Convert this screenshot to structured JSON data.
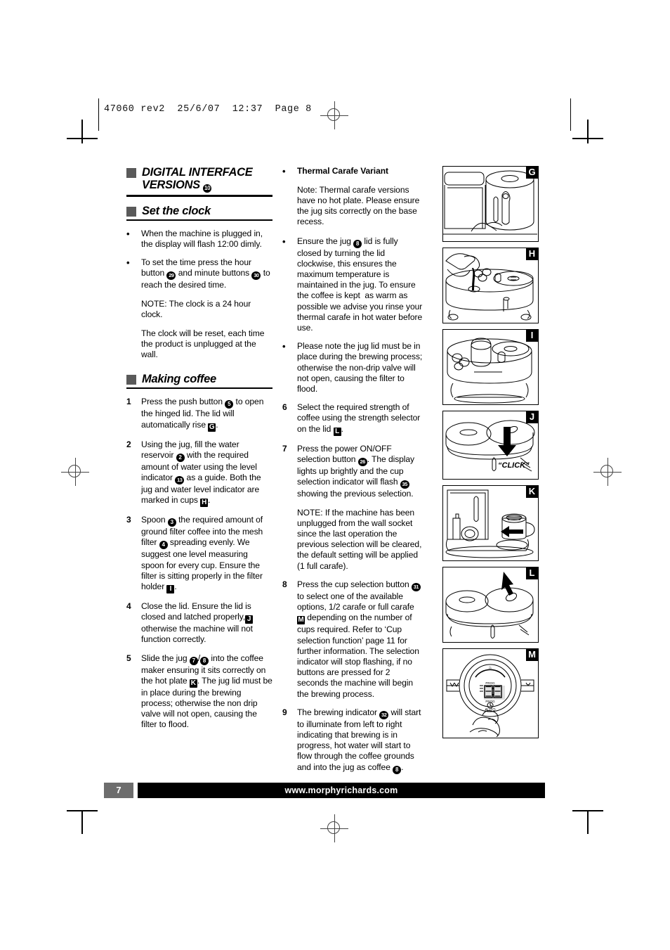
{
  "slug": "47060 rev2  25/6/07  12:37  Page 8",
  "footer": {
    "page_number": "7",
    "url": "www.morphyrichards.com"
  },
  "columns": {
    "left": {
      "heading_main": "DIGITAL INTERFACE VERSIONS",
      "heading_main_ref": "10",
      "heading_sub": "Set the clock",
      "clock_items": [
        {
          "marker": "•",
          "paragraphs": [
            "When the machine is plugged in, the display will flash 12:00 dimly."
          ]
        },
        {
          "marker": "•",
          "paragraphs": [
            "To set the time press the hour button [29] and minute buttons [30] to reach the desired time.",
            "NOTE: The clock is a 24 hour clock.",
            "The clock will be reset, each time the product is unplugged at the wall."
          ]
        }
      ],
      "heading_making": "Making coffee",
      "making_items": [
        {
          "marker": "1",
          "text_parts": [
            "Press the push button ",
            "5",
            " to open the hinged lid. The lid will automatically rise ",
            "G",
            "."
          ]
        },
        {
          "marker": "2",
          "text_parts": [
            "Using the jug, fill the water reservoir ",
            "2",
            " with the required amount of water using the level indicator ",
            "13",
            " as a guide. Both the jug and water level indicator are marked in cups ",
            "H",
            "."
          ]
        },
        {
          "marker": "3",
          "text_parts": [
            "Spoon ",
            "3",
            " the required amount of ground filter coffee into the mesh filter ",
            "4",
            " spreading evenly. We suggest one level measuring spoon for every cup. Ensure the filter is sitting properly in the filter holder ",
            "I",
            "."
          ]
        },
        {
          "marker": "4",
          "text_parts": [
            "Close the lid. Ensure the lid is closed and latched properly,",
            "J",
            " otherwise the machine will not function correctly."
          ]
        },
        {
          "marker": "5",
          "text_parts": [
            "Slide the jug ",
            "7",
            "/",
            "8",
            " into the coffee maker ensuring it sits correctly on the hot plate ",
            "K",
            ". The jug lid must be in place during the brewing process; otherwise the non drip valve will not open, causing the filter to flood."
          ]
        }
      ]
    },
    "middle": {
      "items": [
        {
          "marker": "•",
          "bold_title": "Thermal Carafe Variant",
          "paragraphs": [
            "Note: Thermal carafe versions have no hot plate. Please ensure the jug sits correctly on the base recess."
          ]
        },
        {
          "marker": "•",
          "text_parts": [
            "Ensure the jug ",
            "8",
            " lid is fully closed by turning the lid clockwise, this ensures the maximum temperature is maintained in the jug. To ensure the coffee is kept  as warm as possible we advise you rinse your thermal carafe in hot water before use."
          ]
        },
        {
          "marker": "•",
          "text_parts": [
            "Please note the jug lid must be in place during the brewing process; otherwise the non-drip valve will not open, causing the filter to flood."
          ]
        },
        {
          "marker": "6",
          "text_parts": [
            "Select the required strength of coffee using the strength selector on the lid ",
            "L",
            "."
          ]
        },
        {
          "marker": "7",
          "text_parts": [
            "Press the power ON/OFF selection button ",
            "26",
            ". The display lights up brightly and the cup selection indicator will flash ",
            "35",
            " showing the previous selection."
          ],
          "note": "NOTE: If the machine has been unplugged from the wall socket since the last operation the previous selection will be cleared, the default setting will be applied (1 full carafe)."
        },
        {
          "marker": "8",
          "text_parts": [
            "Press the cup selection button ",
            "31",
            " to select one of the available options, 1/2 carafe or full carafe ",
            "M",
            " depending on the number of cups required. Refer to ‘Cup selection function’ page 11 for further information. The selection indicator will stop flashing, if no buttons are pressed for 2 seconds the machine will begin the brewing process."
          ]
        },
        {
          "marker": "9",
          "text_parts": [
            "The brewing indicator ",
            "32",
            " will start to illuminate from left to right indicating that brewing is in progress, hot water will start to flow through the coffee grounds and into the jug as coffee ",
            "8",
            "."
          ]
        }
      ]
    },
    "right": {
      "panels": [
        {
          "tag": "G",
          "caption": "",
          "alt": "Finger pressing push button on coffee maker lid"
        },
        {
          "tag": "H",
          "caption": "",
          "alt": "Jug pouring water into the water reservoir"
        },
        {
          "tag": "I",
          "caption": "",
          "alt": "Open lid showing mesh filter in filter holder"
        },
        {
          "tag": "J",
          "caption": "“CLICK”",
          "alt": "Arrow pressing lid down until it clicks closed"
        },
        {
          "tag": "K",
          "caption": "",
          "alt": "Arrow showing jug sliding onto hot plate"
        },
        {
          "tag": "L",
          "caption": "",
          "alt": "Arrow pointing to strength selector on the lid"
        },
        {
          "tag": "M",
          "caption": "",
          "alt": "Finger pressing button on the digital control dial with 88:88 display"
        }
      ]
    }
  }
}
